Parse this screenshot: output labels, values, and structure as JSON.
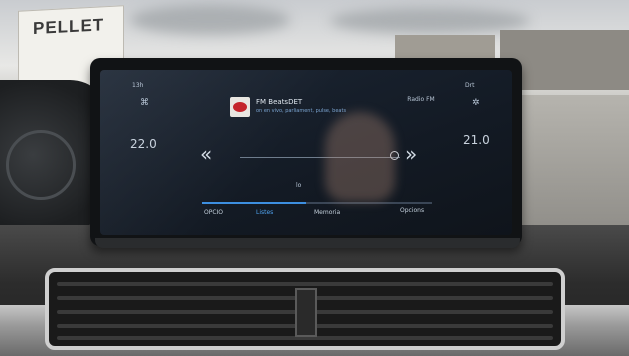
{
  "billboard": {
    "brand_text": "PELLET"
  },
  "screen": {
    "left_top_label": "13h",
    "right_top_label": "Drt",
    "left_temp": "22.0",
    "right_temp": "21.0",
    "source_label": "Radio FM",
    "station_name": "FM BeatsDET",
    "rds_text": "on en vivo, parliament, pulse, beats",
    "rewind_icon": "«",
    "forward_icon": "»",
    "fan_label": "lo",
    "progress_percent": 45,
    "tabs": [
      {
        "label": "OPCIO"
      },
      {
        "label": "Listes"
      },
      {
        "label": "Memoria"
      },
      {
        "label": "Opcions"
      }
    ],
    "active_tab_index": 1,
    "colors": {
      "accent": "#3d8fe0",
      "logo_red": "#c4242b"
    }
  }
}
